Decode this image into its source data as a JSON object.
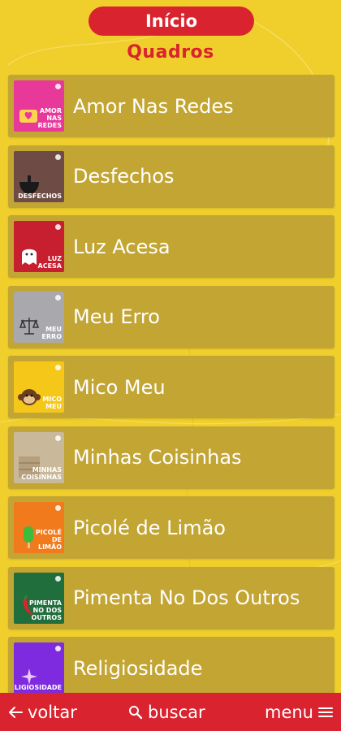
{
  "header": {
    "home_label": "Início",
    "section_title": "Quadros"
  },
  "items": [
    {
      "label": "Amor Nas Redes",
      "thumb_text": "AMOR\nNAS\nREDES",
      "icon": "heart-chat-icon",
      "color": "#e8389a"
    },
    {
      "label": "Desfechos",
      "thumb_text": "DESFECHOS",
      "icon": "bowl-icon",
      "color": "#6e4c45"
    },
    {
      "label": "Luz Acesa",
      "thumb_text": "LUZ\nACESA",
      "icon": "ghost-icon",
      "color": "#c81f30"
    },
    {
      "label": "Meu Erro",
      "thumb_text": "MEU\nERRO",
      "icon": "scale-icon",
      "color": "#a9a9ad"
    },
    {
      "label": "Mico Meu",
      "thumb_text": "MICO\nMEU",
      "icon": "monkey-icon",
      "color": "#f5c718"
    },
    {
      "label": "Minhas Coisinhas",
      "thumb_text": "MINHAS\nCOISINHAS",
      "icon": "wood-icon",
      "color": "#c9b89a"
    },
    {
      "label": "Picolé de Limão",
      "thumb_text": "PICOLÉ\nDE\nLIMÃO",
      "icon": "popsicle-icon",
      "color": "#f07a1c"
    },
    {
      "label": "Pimenta No Dos Outros",
      "thumb_text": "PIMENTA\nNO DOS OUTROS",
      "icon": "pepper-icon",
      "color": "#1f6e3c"
    },
    {
      "label": "Religiosidade",
      "thumb_text": "RELIGIOSIDADE",
      "icon": "sparkle-icon",
      "color": "#7e2be0"
    }
  ],
  "bottom_bar": {
    "back_label": "voltar",
    "search_label": "buscar",
    "menu_label": "menu"
  },
  "colors": {
    "background": "#f0cf2c",
    "accent": "#d9232e",
    "card": "#c3a534"
  }
}
